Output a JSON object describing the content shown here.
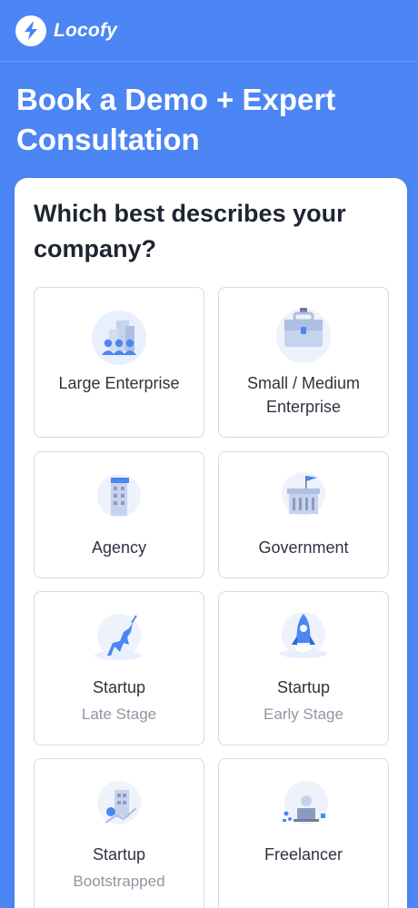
{
  "header": {
    "brand": "Locofy",
    "logo_icon": "lightning-bolt-icon"
  },
  "page": {
    "title": "Book a Demo + Expert Consultation"
  },
  "form": {
    "question": "Which best describes your company?",
    "options": [
      {
        "label": "Large Enterprise",
        "sub": "",
        "icon": "office-team-icon"
      },
      {
        "label": "Small / Medium Enterprise",
        "sub": "",
        "icon": "briefcase-icon"
      },
      {
        "label": "Agency",
        "sub": "",
        "icon": "building-flag-icon"
      },
      {
        "label": "Government",
        "sub": "",
        "icon": "government-building-icon"
      },
      {
        "label": "Startup",
        "sub": "Late Stage",
        "icon": "unicorn-icon"
      },
      {
        "label": "Startup",
        "sub": "Early Stage",
        "icon": "rocket-icon"
      },
      {
        "label": "Startup",
        "sub": "Bootstrapped",
        "icon": "growth-building-icon"
      },
      {
        "label": "Freelancer",
        "sub": "",
        "icon": "laptop-person-icon"
      }
    ]
  },
  "colors": {
    "background": "#4c85f4",
    "accent": "#4c85f4",
    "card": "#ffffff",
    "option_border": "#d6dae3",
    "subtext": "#8f96a3"
  }
}
